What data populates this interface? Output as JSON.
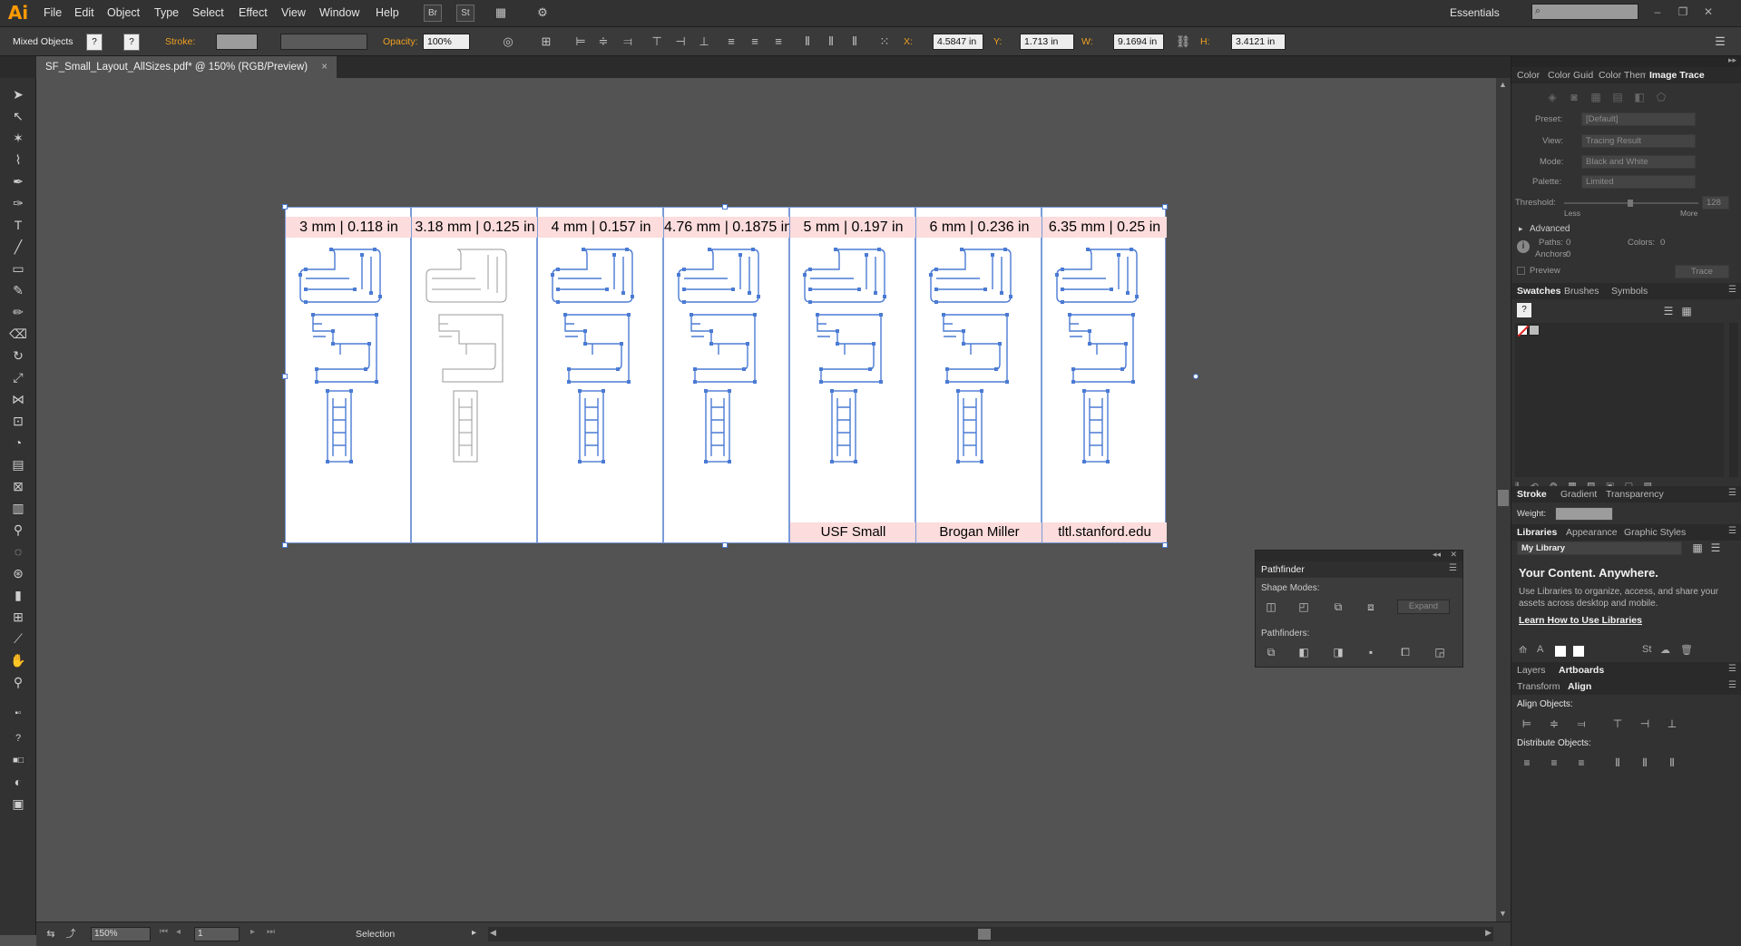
{
  "app": {
    "logo": "Ai"
  },
  "menu": {
    "items": [
      "File",
      "Edit",
      "Object",
      "Type",
      "Select",
      "Effect",
      "View",
      "Window",
      "Help"
    ],
    "bridge_label": "Br",
    "stock_label": "St",
    "workspace": "Essentials"
  },
  "control": {
    "selection_type": "Mixed Objects",
    "stroke_label": "Stroke:",
    "opacity_label": "Opacity:",
    "opacity_value": "100%",
    "x_label": "X:",
    "x_value": "4.5847 in",
    "y_label": "Y:",
    "y_value": "1.713 in",
    "w_label": "W:",
    "w_value": "9.1694 in",
    "h_label": "H:",
    "h_value": "3.4121 in"
  },
  "document": {
    "tab_title": "SF_Small_Layout_AllSizes.pdf* @ 150% (RGB/Preview)",
    "close": "×"
  },
  "artboards": [
    {
      "label": "3 mm | 0.118 in",
      "style": "filled",
      "bottom_label": ""
    },
    {
      "label": "3.18 mm | 0.125 in",
      "style": "outline",
      "bottom_label": ""
    },
    {
      "label": "4 mm | 0.157 in",
      "style": "filled",
      "bottom_label": ""
    },
    {
      "label": "4.76 mm | 0.1875 in",
      "style": "filled",
      "bottom_label": ""
    },
    {
      "label": "5 mm | 0.197 in",
      "style": "filled",
      "bottom_label": "USF Small"
    },
    {
      "label": "6 mm | 0.236 in",
      "style": "filled",
      "bottom_label": "Brogan Miller"
    },
    {
      "label": "6.35 mm | 0.25 in",
      "style": "filled",
      "bottom_label": "tltl.stanford.edu"
    }
  ],
  "status": {
    "zoom": "150%",
    "page": "1",
    "mode": "Selection"
  },
  "image_trace": {
    "tabs": [
      "Color",
      "Color Guide",
      "Color Themes",
      "Image Trace"
    ],
    "active": "Image Trace",
    "preset_label": "Preset:",
    "preset_value": "[Default]",
    "view_label": "View:",
    "view_value": "Tracing Result",
    "mode_label": "Mode:",
    "mode_value": "Black and White",
    "palette_label": "Palette:",
    "palette_value": "Limited",
    "threshold_label": "Threshold:",
    "threshold_value": "128",
    "less": "Less",
    "more": "More",
    "advanced": "Advanced",
    "paths_label": "Paths:",
    "paths_value": "0",
    "anchors_label": "Anchors:",
    "anchors_value": "0",
    "colors_label": "Colors:",
    "colors_value": "0",
    "preview": "Preview",
    "trace": "Trace"
  },
  "swatches": {
    "tabs": [
      "Swatches",
      "Brushes",
      "Symbols"
    ],
    "active": "Swatches"
  },
  "stroke_panel": {
    "tabs": [
      "Stroke",
      "Gradient",
      "Transparency"
    ],
    "active": "Stroke",
    "weight_label": "Weight:"
  },
  "libraries": {
    "tabs": [
      "Libraries",
      "Appearance",
      "Graphic Styles"
    ],
    "active": "Libraries",
    "library": "My Library",
    "heading": "Your Content. Anywhere.",
    "body": "Use Libraries to organize, access, and share your assets across desktop and mobile.",
    "link": "Learn How to Use Libraries"
  },
  "layers": {
    "tabs": [
      "Layers",
      "Artboards"
    ],
    "active": "Artboards"
  },
  "align": {
    "tabs": [
      "Transform",
      "Align"
    ],
    "active": "Align",
    "align_objects": "Align Objects:",
    "distribute_objects": "Distribute Objects:"
  },
  "pathfinder": {
    "title": "Pathfinder",
    "shape_modes": "Shape Modes:",
    "expand": "Expand",
    "pathfinders": "Pathfinders:"
  },
  "colors": {
    "accent": "#4b7bd4",
    "label_bg": "#fcdcdc",
    "canvas": "#535353",
    "logo": "#ff9a00"
  }
}
